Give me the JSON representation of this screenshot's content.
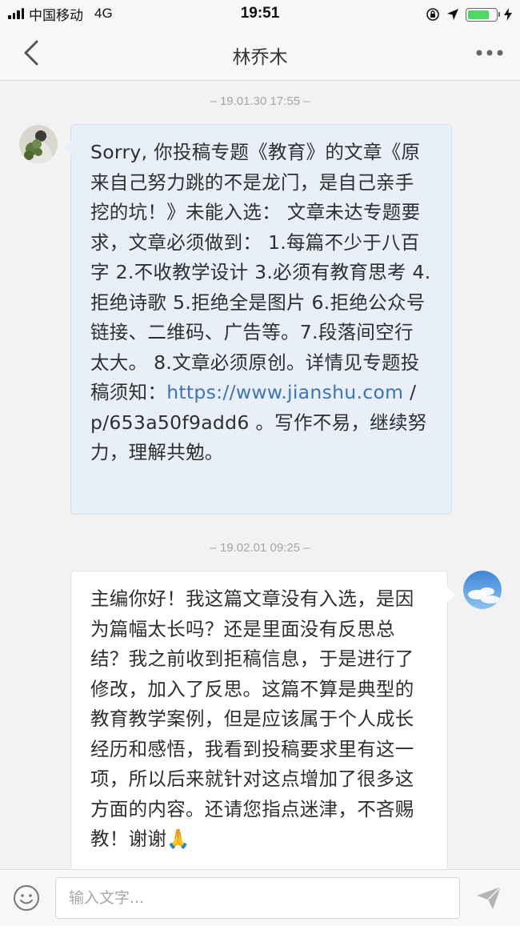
{
  "status_bar": {
    "carrier": "中国移动",
    "network": "4G",
    "time": "19:51"
  },
  "nav": {
    "title": "林乔木",
    "back_icon": "chevron-left-icon",
    "more_icon": "more-dots-icon"
  },
  "messages": [
    {
      "timestamp": "– 19.01.30 17:55 –",
      "side": "left",
      "text_before_link": "Sorry, 你投稿专题《教育》的文章《原来自己努力跳的不是龙门，是自己亲手挖的坑！》未能入选： 文章未达专题要求，文章必须做到： 1.每篇不少于八百字 2.不收教学设计 3.必须有教育思考  4.拒绝诗歌 5.拒绝全是图片 6.拒绝公众号链接、二维码、广告等。7.段落间空行太大。 8.文章必须原创。详情见专题投稿须知：",
      "link": "https://www.jianshu.com",
      "text_after_link": " /p/653a50f9add6 。写作不易，继续努力，理解共勉。"
    },
    {
      "timestamp": "– 19.02.01 09:25 –",
      "side": "right",
      "text": "主编你好！我这篇文章没有入选，是因为篇幅太长吗？还是里面没有反思总结？我之前收到拒稿信息，于是进行了修改，加入了反思。这篇不算是典型的教育教学案例，但是应该属于个人成长经历和感悟，我看到投稿要求里有这一项，所以后来就针对这点增加了很多这方面的内容。还请您指点迷津，不吝赐教！谢谢🙏"
    }
  ],
  "input_bar": {
    "placeholder": "输入文字...",
    "emoji_icon": "smiley-icon",
    "send_icon": "send-icon"
  },
  "colors": {
    "left_bubble": "#e8eff8",
    "right_bubble": "#ffffff",
    "link": "#3e74b4",
    "battery": "#4cd964"
  }
}
